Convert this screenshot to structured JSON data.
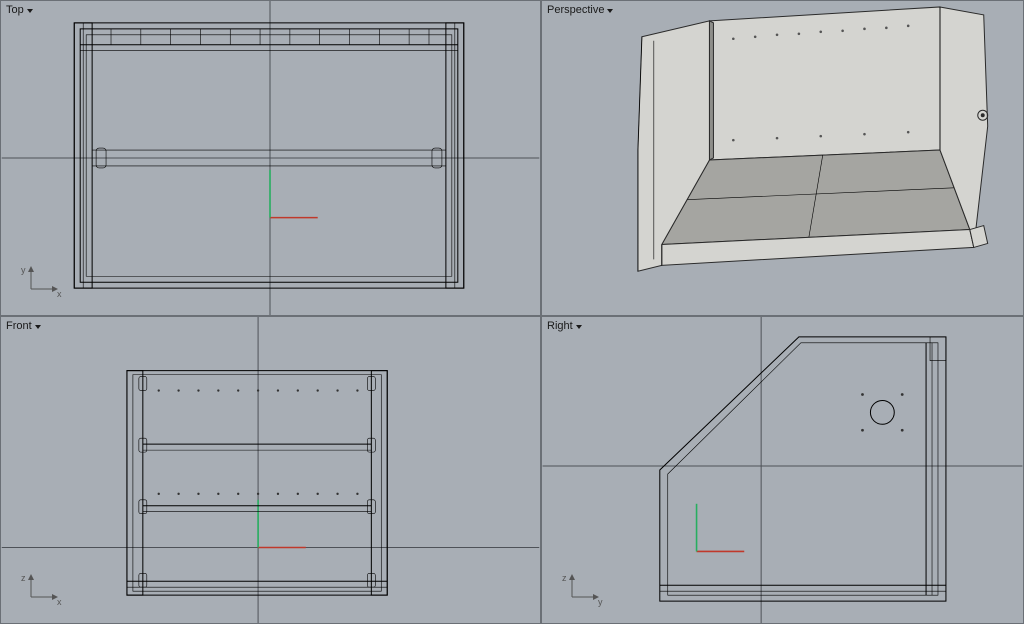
{
  "viewports": {
    "top": {
      "label": "Top",
      "axis1": "y",
      "axis2": "x"
    },
    "perspective": {
      "label": "Perspective",
      "axis1": "",
      "axis2": ""
    },
    "front": {
      "label": "Front",
      "axis1": "z",
      "axis2": "x"
    },
    "right": {
      "label": "Right",
      "axis1": "z",
      "axis2": "y"
    }
  }
}
